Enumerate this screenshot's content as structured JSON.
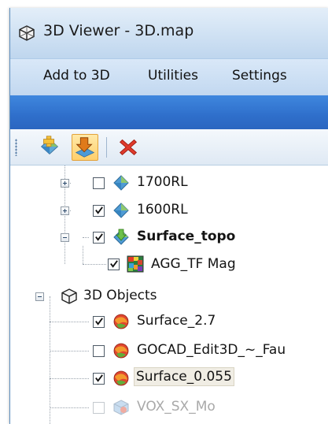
{
  "window": {
    "title": "3D Viewer - 3D.map",
    "icon": "wireframe-cube-icon"
  },
  "menu": {
    "items": [
      "Add to 3D",
      "Utilities",
      "Settings"
    ]
  },
  "toolbar": {
    "buttons": [
      {
        "name": "add-layer",
        "icon": "add-layer-icon"
      },
      {
        "name": "import",
        "icon": "import-arrow-icon",
        "active": true
      },
      {
        "name": "remove",
        "icon": "red-x-icon"
      }
    ]
  },
  "tree": {
    "items": [
      {
        "label": "1700RL",
        "checked": false,
        "expander": "plus",
        "icon": "surface-diamond-icon"
      },
      {
        "label": "1600RL",
        "checked": true,
        "expander": "plus",
        "icon": "surface-diamond-icon"
      },
      {
        "label": "Surface_topo",
        "checked": true,
        "expander": "minus",
        "icon": "surface-diamond-arrow-icon",
        "bold": true
      },
      {
        "label": "AGG_TF Mag",
        "checked": true,
        "icon": "grid-raster-icon"
      },
      {
        "label": "3D Objects",
        "expander": "minus",
        "icon": "wireframe-cube-icon"
      },
      {
        "label": "Surface_2.7",
        "checked": true,
        "icon": "surface-object-icon"
      },
      {
        "label": "GOCAD_Edit3D_~_Fau",
        "checked": false,
        "icon": "surface-object-icon"
      },
      {
        "label": "Surface_0.055",
        "checked": true,
        "icon": "surface-object-icon",
        "highlighted": true
      },
      {
        "label": "VOX_SX_Mo",
        "checked": false,
        "icon": "voxel-icon",
        "dimmed": true
      }
    ]
  },
  "colors": {
    "titlebar": "#cfe1f3",
    "menubar": "#c8dcf2",
    "accent_bar": "#2f6fcb",
    "selection": "#f0ede4"
  }
}
